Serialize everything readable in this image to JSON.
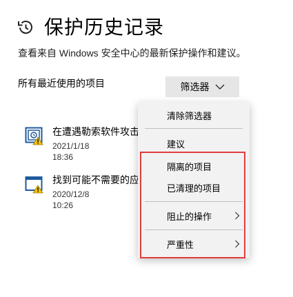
{
  "header": {
    "title": "保护历史记录",
    "icon": "history-icon",
    "description": "查看来自 Windows 安全中心的最新保护操作和建议。"
  },
  "list": {
    "label": "所有最近使用的项目",
    "filter_button": "筛选器",
    "items": [
      {
        "title": "在遭遇勒索软件攻击",
        "date": "2021/1/18 18:36",
        "icon": "ransomware-warning-icon"
      },
      {
        "title": "找到可能不需要的应用",
        "date": "2020/12/8 10:26",
        "icon": "pua-warning-icon"
      }
    ]
  },
  "filter_menu": {
    "clear": "清除筛选器",
    "recommendations": "建议",
    "quarantined": "隔离的项目",
    "cleaned": "已清理的项目",
    "blocked_actions": "阻止的操作",
    "severity": "严重性"
  },
  "colors": {
    "highlight_border": "#e03c3c",
    "menu_background": "#f2f2f2",
    "button_background": "#e6e6e6",
    "warning_yellow": "#f5c400",
    "icon_blue": "#1e5a9e"
  }
}
